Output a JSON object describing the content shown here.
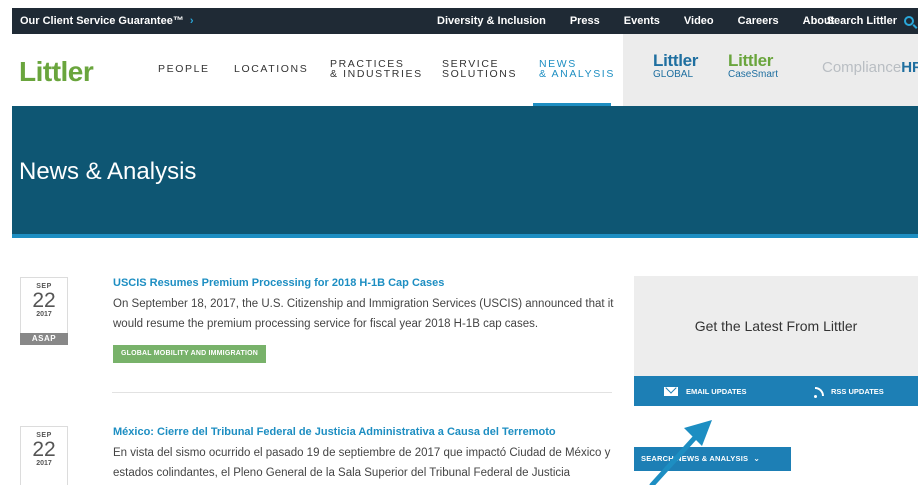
{
  "topbar": {
    "guarantee": "Our Client Service Guarantee™",
    "guarantee_chevron": "›",
    "links": [
      "Diversity & Inclusion",
      "Press",
      "Events",
      "Video",
      "Careers",
      "About"
    ],
    "search_label": "Search Littler"
  },
  "nav": {
    "logo": "Littler",
    "items": [
      {
        "label": "PEOPLE"
      },
      {
        "label": "LOCATIONS"
      },
      {
        "line1": "PRACTICES",
        "line2": "& INDUSTRIES"
      },
      {
        "line1": "SERVICE",
        "line2": "SOLUTIONS"
      },
      {
        "line1": "NEWS",
        "line2": "& ANALYSIS"
      }
    ],
    "brands": {
      "global_l1": "Littler",
      "global_l2": "GLOBAL",
      "casesmart_l1": "Littler",
      "casesmart_l2": "CaseSmart",
      "compliance_prefix": "Compliance",
      "compliance_suffix": "HR"
    }
  },
  "hero": {
    "title": "News & Analysis"
  },
  "articles": [
    {
      "month": "SEP",
      "day": "22",
      "year": "2017",
      "tag_box": "ASAP",
      "title": "USCIS Resumes Premium Processing for 2018 H-1B Cap Cases",
      "body": "On September 18, 2017, the U.S. Citizenship and Immigration Services (USCIS) announced that it would resume the premium processing service for fiscal year 2018 H-1B cap cases.",
      "category": "GLOBAL MOBILITY AND IMMIGRATION"
    },
    {
      "month": "SEP",
      "day": "22",
      "year": "2017",
      "title": "México: Cierre del Tribunal Federal de Justicia Administrativa a Causa del Terremoto",
      "body": "En vista del sismo ocurrido el pasado 19 de septiembre de 2017 que impactó Ciudad de México y estados colindantes, el Pleno General de la Sala Superior del Tribunal Federal de Justicia"
    }
  ],
  "sidebar": {
    "cta": "Get the Latest From Littler",
    "email_updates": "EMAIL UPDATES",
    "rss_updates": "RSS UPDATES",
    "search_button": "SEARCH NEWS & ANALYSIS",
    "search_chevron": "⌄"
  },
  "colors": {
    "topbar": "#1f2a35",
    "accent_blue": "#1d8ec2",
    "hero": "#0e5673",
    "logo_green": "#6aa53d",
    "tag_green": "#78b26a"
  }
}
